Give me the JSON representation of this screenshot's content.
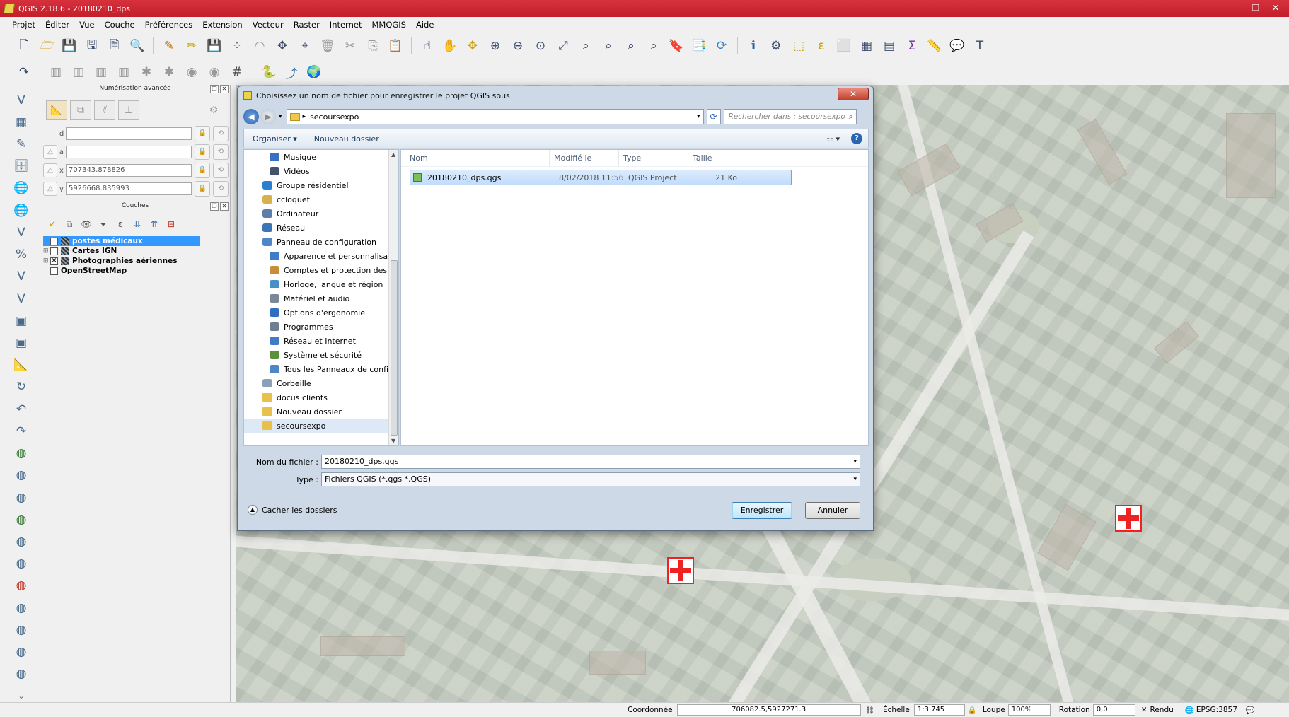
{
  "window": {
    "title": "QGIS 2.18.6 - 20180210_dps",
    "controls": [
      "–",
      "❐",
      "✕"
    ]
  },
  "menubar": {
    "items": [
      {
        "label": "Projet"
      },
      {
        "label": "Éditer"
      },
      {
        "label": "Vue"
      },
      {
        "label": "Couche"
      },
      {
        "label": "Préférences"
      },
      {
        "label": "Extension"
      },
      {
        "label": "Vecteur"
      },
      {
        "label": "Raster"
      },
      {
        "label": "Internet"
      },
      {
        "label": "MMQGIS"
      },
      {
        "label": "Aide"
      }
    ]
  },
  "advanced_digitizing": {
    "title": "Numérisation avancée",
    "fields": [
      {
        "label": "d",
        "value": ""
      },
      {
        "label": "a",
        "value": ""
      },
      {
        "label": "x",
        "value": "707343.878826"
      },
      {
        "label": "y",
        "value": "5926668.835993"
      }
    ]
  },
  "layers_panel": {
    "title": "Couches",
    "layers": [
      {
        "name": "postes médicaux",
        "checked": true,
        "selected": true
      },
      {
        "name": "Cartes IGN",
        "checked": false,
        "selected": false
      },
      {
        "name": "Photographies aériennes",
        "checked": true,
        "selected": false
      },
      {
        "name": "OpenStreetMap",
        "checked": false,
        "selected": false
      }
    ]
  },
  "dialog": {
    "title": "Choisissez un nom de fichier pour enregistrer le projet QGIS sous",
    "close_label": "✕",
    "address": "secoursexpo",
    "search_placeholder": "Rechercher dans : secoursexpo",
    "commands": {
      "organize": "Organiser ▾",
      "new_folder": "Nouveau dossier"
    },
    "nav_items": [
      {
        "label": "Musique",
        "indent": 2,
        "icon": "music-icon",
        "color": "#3a6fc4"
      },
      {
        "label": "Vidéos",
        "indent": 2,
        "icon": "video-icon",
        "color": "#44526b"
      },
      {
        "label": "Groupe résidentiel",
        "indent": 1,
        "icon": "homegroup-icon",
        "color": "#2a7fd1"
      },
      {
        "label": "ccloquet",
        "indent": 1,
        "icon": "user-folder-icon",
        "color": "#d9b14a"
      },
      {
        "label": "Ordinateur",
        "indent": 1,
        "icon": "computer-icon",
        "color": "#5b7fa8"
      },
      {
        "label": "Réseau",
        "indent": 1,
        "icon": "network-icon",
        "color": "#3b75b3"
      },
      {
        "label": "Panneau de configuration",
        "indent": 1,
        "icon": "control-panel-icon",
        "color": "#4f86c6"
      },
      {
        "label": "Apparence et personnalisation",
        "indent": 2,
        "icon": "appearance-icon",
        "color": "#3f7bc6"
      },
      {
        "label": "Comptes et protection des util",
        "indent": 2,
        "icon": "accounts-icon",
        "color": "#c88d3a"
      },
      {
        "label": "Horloge, langue et région",
        "indent": 2,
        "icon": "clock-icon",
        "color": "#4a90c8"
      },
      {
        "label": "Matériel et audio",
        "indent": 2,
        "icon": "hardware-icon",
        "color": "#7a8796"
      },
      {
        "label": "Options d'ergonomie",
        "indent": 2,
        "icon": "accessibility-icon",
        "color": "#2e6fbf"
      },
      {
        "label": "Programmes",
        "indent": 2,
        "icon": "programs-icon",
        "color": "#6d7f90"
      },
      {
        "label": "Réseau et Internet",
        "indent": 2,
        "icon": "network-internet-icon",
        "color": "#3f7bc6"
      },
      {
        "label": "Système et sécurité",
        "indent": 2,
        "icon": "security-icon",
        "color": "#5a8f3c"
      },
      {
        "label": "Tous les Panneaux de configur",
        "indent": 2,
        "icon": "all-panels-icon",
        "color": "#4f86c6"
      },
      {
        "label": "Corbeille",
        "indent": 1,
        "icon": "recycle-bin-icon",
        "color": "#8aa0b8"
      },
      {
        "label": "docus clients",
        "indent": 1,
        "icon": "folder-icon",
        "color": "#e9c14a"
      },
      {
        "label": "Nouveau dossier",
        "indent": 1,
        "icon": "folder-icon",
        "color": "#e9c14a"
      },
      {
        "label": "secoursexpo",
        "indent": 1,
        "icon": "folder-icon",
        "color": "#e9c14a",
        "selected": true
      }
    ],
    "columns": {
      "name": "Nom",
      "modified": "Modifié le",
      "type": "Type",
      "size": "Taille"
    },
    "files": [
      {
        "name": "20180210_dps.qgs",
        "modified": "8/02/2018 11:56",
        "type": "QGIS Project",
        "size": "21 Ko"
      }
    ],
    "filename_label": "Nom du fichier :",
    "filename_value": "20180210_dps.qgs",
    "type_label": "Type :",
    "type_value": "Fichiers QGIS (*.qgs *.QGS)",
    "hide_folders": "Cacher les dossiers",
    "save_button": "Enregistrer",
    "cancel_button": "Annuler"
  },
  "statusbar": {
    "coord_label": "Coordonnée",
    "coord_value": "706082.5,5927271.3",
    "scale_label": "Échelle",
    "scale_value": "1:3.745",
    "magnifier_label": "Loupe",
    "magnifier_value": "100%",
    "rotation_label": "Rotation",
    "rotation_value": "0,0",
    "render_label": "Rendu",
    "epsg_label": "EPSG:3857"
  }
}
